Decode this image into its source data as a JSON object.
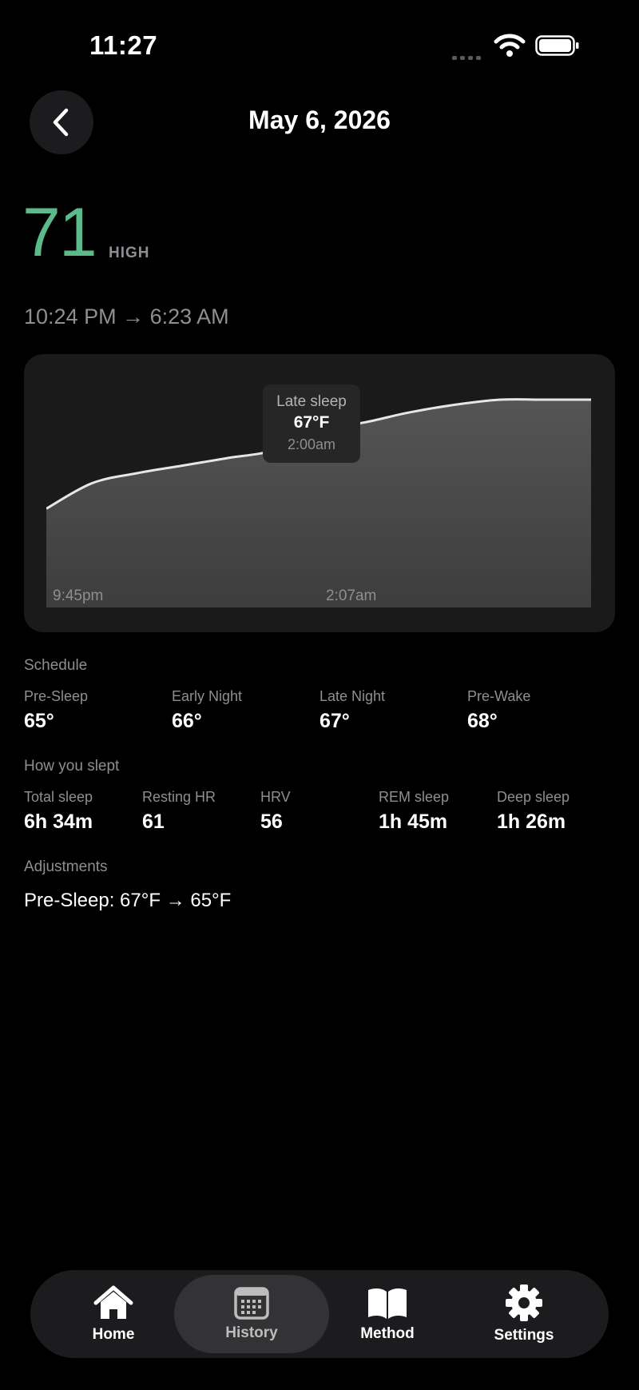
{
  "status_bar": {
    "time": "11:27"
  },
  "header": {
    "date": "May 6, 2026"
  },
  "score": {
    "value": "71",
    "label": "HIGH",
    "color": "#5cba8a"
  },
  "sleep_range": "10:24 PM → 6:23 AM",
  "chart_data": {
    "type": "area",
    "x_tick_labels": [
      "9:45pm",
      "2:07am"
    ],
    "series": [
      {
        "x": [
          "9:45pm",
          "10:15pm",
          "10:45pm",
          "11:30pm",
          "12:15am",
          "1:00am",
          "2:00am",
          "2:45am",
          "3:30am",
          "4:15am",
          "5:00am",
          "5:45am",
          "6:30am"
        ],
        "values": [
          63.9,
          64.9,
          65.3,
          65.6,
          65.9,
          66.2,
          67.0,
          67.3,
          67.7,
          68.0,
          68.2,
          68.2,
          68.2
        ]
      }
    ],
    "highlight": {
      "label": "Late sleep",
      "value": "67°F",
      "time": "2:00am"
    }
  },
  "schedule": {
    "title": "Schedule",
    "items": [
      {
        "label": "Pre-Sleep",
        "value": "65°"
      },
      {
        "label": "Early Night",
        "value": "66°"
      },
      {
        "label": "Late Night",
        "value": "67°"
      },
      {
        "label": "Pre-Wake",
        "value": "68°"
      }
    ]
  },
  "how_you_slept": {
    "title": "How you slept",
    "items": [
      {
        "label": "Total sleep",
        "value": "6h 34m"
      },
      {
        "label": "Resting HR",
        "value": "61"
      },
      {
        "label": "HRV",
        "value": "56"
      },
      {
        "label": "REM sleep",
        "value": "1h 45m"
      },
      {
        "label": "Deep sleep",
        "value": "1h 26m"
      }
    ]
  },
  "adjustments": {
    "title": "Adjustments",
    "items": [
      "Pre-Sleep: 67°F → 65°F"
    ]
  },
  "tabs": [
    {
      "label": "Home",
      "icon": "house-icon"
    },
    {
      "label": "History",
      "icon": "calendar-icon",
      "active": true
    },
    {
      "label": "Method",
      "icon": "book-icon"
    },
    {
      "label": "Settings",
      "icon": "gear-icon"
    }
  ]
}
